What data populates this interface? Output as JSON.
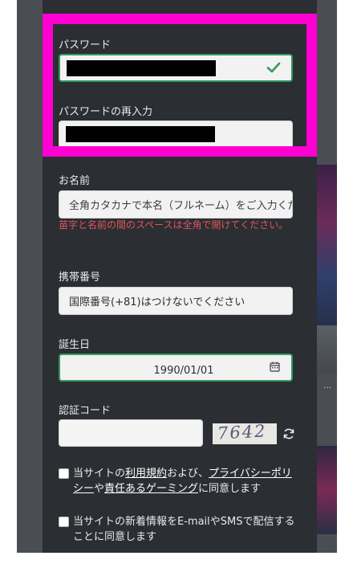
{
  "form": {
    "password_label": "パスワード",
    "password_confirm_label": "パスワードの再入力",
    "name_label": "お名前",
    "name_placeholder": "全角カタカナで本名（フルネーム）をご入力ください",
    "name_error": "苗字と名前の間のスペースは全角で開けてください。",
    "phone_label": "携帯番号",
    "phone_placeholder": "国際番号(+81)はつけないでください",
    "birthday_label": "誕生日",
    "birthday_value": "1990/01/01",
    "captcha_label": "認証コード",
    "captcha_text": "7642"
  },
  "agreements": {
    "terms_prefix": "当サイトの",
    "terms_link": "利用規約",
    "terms_mid1": "および、",
    "privacy_link": "プライバシーポリシー",
    "terms_mid2": "や",
    "gaming_link": "責任あるゲーミング",
    "terms_suffix": "に同意します",
    "newsletter": "当サイトの新着情報をE-mailやSMSで配信することに同意します"
  },
  "colors": {
    "panel": "#2b2e33",
    "highlight": "#ff00d2",
    "valid_green": "#2f9a5c",
    "error_red": "#e0565c"
  },
  "icons": [
    "checkmark-icon",
    "calendar-icon",
    "refresh-icon"
  ]
}
